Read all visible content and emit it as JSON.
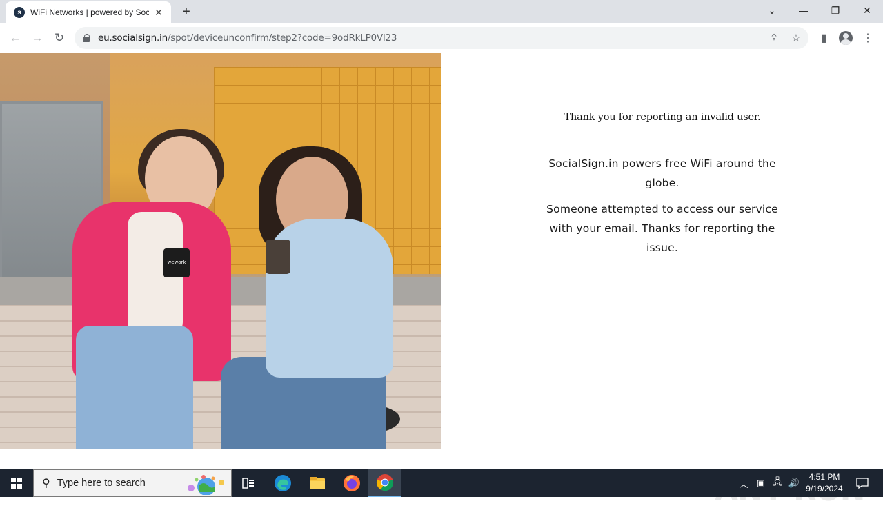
{
  "browser": {
    "tab": {
      "title": "WiFi Networks | powered by Soc",
      "favicon": "socialsign-favicon-icon"
    },
    "address_bar": {
      "host": "eu.socialsign.in",
      "path": "/spot/deviceunconfirm/step2?code=9odRkLP0Vl23"
    },
    "icons": {
      "back": "←",
      "forward": "→",
      "reload": "↻",
      "new_tab": "+",
      "tab_close": "✕",
      "share": "⇪",
      "bookmark": "☆",
      "sidepanel": "▮",
      "menu": "⋮",
      "tab_search": "⌄",
      "minimize": "—",
      "restore": "❐",
      "close": "✕"
    }
  },
  "page": {
    "hero_image_alt": "wework",
    "message": {
      "title": "Thank you for reporting an invalid user.",
      "paragraph1": "SocialSign.in powers free WiFi around the globe.",
      "paragraph2": "Someone attempted to access our service with your email. Thanks for reporting the issue."
    },
    "watermark": "ANY RUN"
  },
  "taskbar": {
    "search_placeholder": "Type here to search",
    "time": "4:51 PM",
    "date": "9/19/2024",
    "pinned": [
      "task-view-icon",
      "edge-icon",
      "file-explorer-icon",
      "firefox-icon",
      "chrome-icon"
    ]
  }
}
